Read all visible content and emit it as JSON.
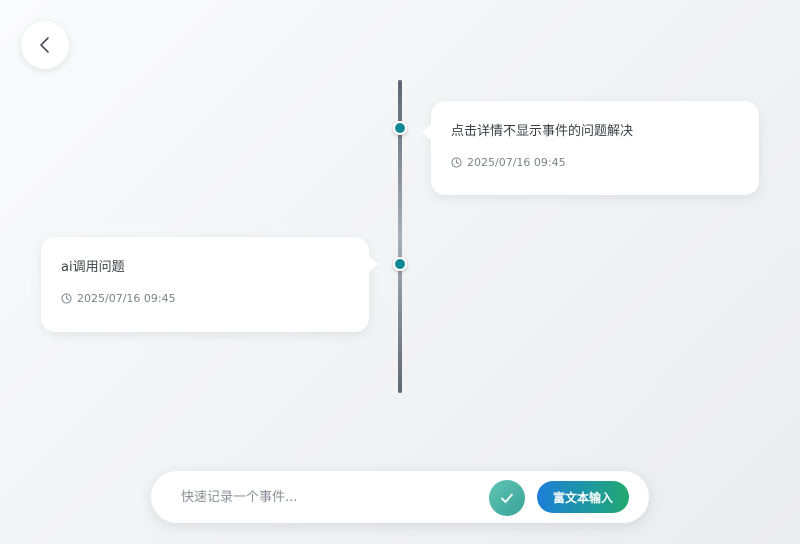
{
  "header": {
    "back_icon": "chevron-left-icon"
  },
  "timeline": {
    "events": [
      {
        "title": "点击详情不显示事件的问题解决",
        "time": "2025/07/16 09:45",
        "side": "right"
      },
      {
        "title": "ai调用问题",
        "time": "2025/07/16 09:45",
        "side": "left"
      }
    ],
    "dot_color": "#0f8a94",
    "time_icon": "clock-icon"
  },
  "composer": {
    "placeholder": "快速记录一个事件...",
    "value": "",
    "confirm_icon": "check-icon",
    "rich_text_label": "富文本输入",
    "accent_start": "#1d7fd9",
    "accent_end": "#22a86e"
  }
}
